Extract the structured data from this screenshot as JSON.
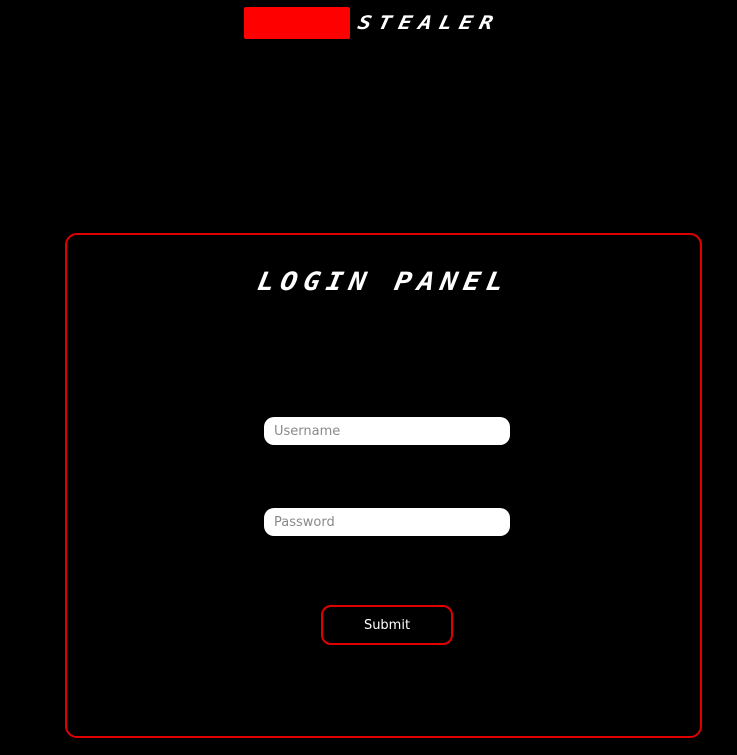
{
  "header": {
    "brand_word": "Stealer",
    "brand_block_color": "#ff0000"
  },
  "login_panel": {
    "title": "Login Panel",
    "border_color": "#e00000",
    "username": {
      "placeholder": "Username",
      "value": ""
    },
    "password": {
      "placeholder": "Password",
      "value": ""
    },
    "submit_label": "Submit"
  }
}
